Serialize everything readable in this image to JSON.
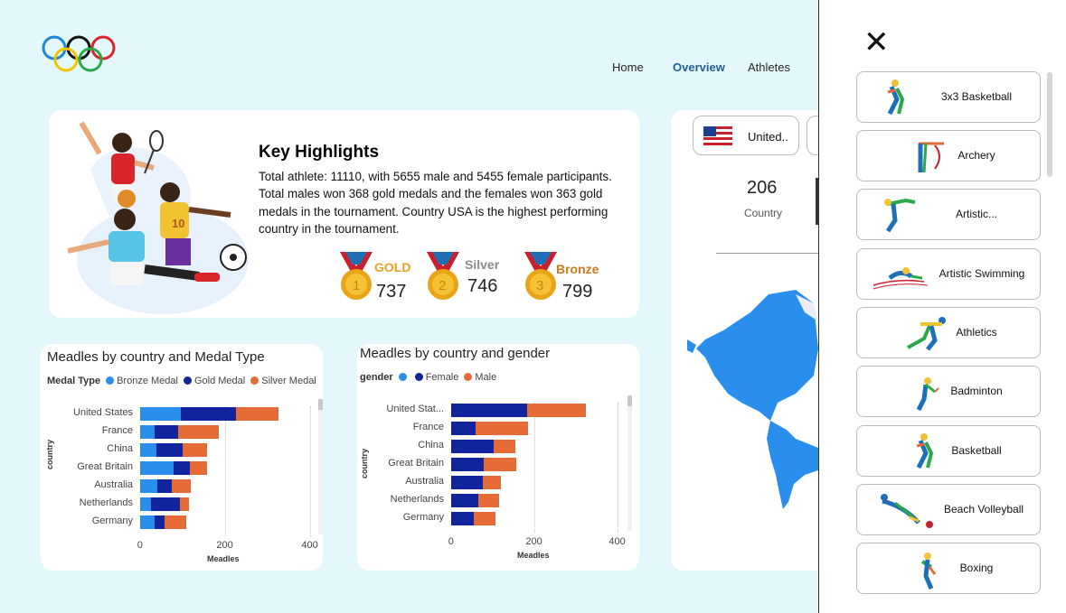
{
  "nav": {
    "home": "Home",
    "overview": "Overview",
    "athletes": "Athletes"
  },
  "highlights": {
    "title": "Key Highlights",
    "body": "Total athlete: 11110, with 5655 male and 5455 female participants. Total males won 368 gold medals and the females won 363 gold medals in the tournament. Country USA is the highest performing country in the tournament.",
    "medals": [
      {
        "label": "GOLD",
        "value": "737",
        "color": "#e3a51f"
      },
      {
        "label": "Silver",
        "value": "746",
        "color": "#8a8a8a"
      },
      {
        "label": "Bronze",
        "value": "799",
        "color": "#cc7a1e"
      }
    ]
  },
  "chart1": {
    "title": "Meadles by country and Medal Type",
    "legend_title": "Medal Type",
    "ylabel": "country",
    "xlabel": "Meadles",
    "chart_data": {
      "type": "bar",
      "orientation": "horizontal-stacked",
      "categories": [
        "United States",
        "France",
        "China",
        "Great Britain",
        "Australia",
        "Netherlands",
        "Germany"
      ],
      "series": [
        {
          "name": "Bronze Medal",
          "color": "#2a8fec",
          "values": [
            95,
            35,
            38,
            78,
            40,
            25,
            35
          ]
        },
        {
          "name": "Gold Medal",
          "color": "#12239e",
          "values": [
            130,
            55,
            62,
            40,
            35,
            68,
            22
          ]
        },
        {
          "name": "Silver Medal",
          "color": "#e66c37",
          "values": [
            100,
            95,
            58,
            40,
            45,
            22,
            52
          ]
        }
      ],
      "xticks": [
        "0",
        "200",
        "400"
      ],
      "xlim": [
        0,
        400
      ]
    }
  },
  "chart2": {
    "title": "Meadles by country and gender",
    "legend_title": "gender",
    "ylabel": "country",
    "xlabel": "Meadles",
    "chart_data": {
      "type": "bar",
      "orientation": "horizontal-stacked",
      "categories": [
        "United Stat...",
        "France",
        "China",
        "Great Britain",
        "Australia",
        "Netherlands",
        "Germany"
      ],
      "series": [
        {
          "name": "",
          "color": "#2a8fec",
          "values": [
            0,
            0,
            0,
            0,
            0,
            0,
            0
          ]
        },
        {
          "name": "Female",
          "color": "#12239e",
          "values": [
            183,
            58,
            102,
            78,
            75,
            65,
            55
          ]
        },
        {
          "name": "Male",
          "color": "#e66c37",
          "values": [
            142,
            127,
            53,
            78,
            45,
            50,
            52
          ]
        }
      ],
      "xticks": [
        "0",
        "200",
        "400"
      ],
      "xlim": [
        0,
        400
      ]
    }
  },
  "right_card": {
    "country_select": "United..",
    "kpi_value": "206",
    "kpi_label": "Country"
  },
  "panel": {
    "close": "✕",
    "sports": [
      {
        "label": "3x3 Basketball",
        "icon": "basketball-player-icon"
      },
      {
        "label": "Archery",
        "icon": "archery-icon"
      },
      {
        "label": "Artistic...",
        "icon": "gymnast-icon"
      },
      {
        "label": "Artistic Swimming",
        "icon": "swimmer-icon"
      },
      {
        "label": "Athletics",
        "icon": "runner-icon"
      },
      {
        "label": "Badminton",
        "icon": "badminton-player-icon"
      },
      {
        "label": "Basketball",
        "icon": "basketball-player-icon"
      },
      {
        "label": "Beach Volleyball",
        "icon": "volleyball-player-icon"
      },
      {
        "label": "Boxing",
        "icon": "boxer-icon"
      }
    ]
  }
}
